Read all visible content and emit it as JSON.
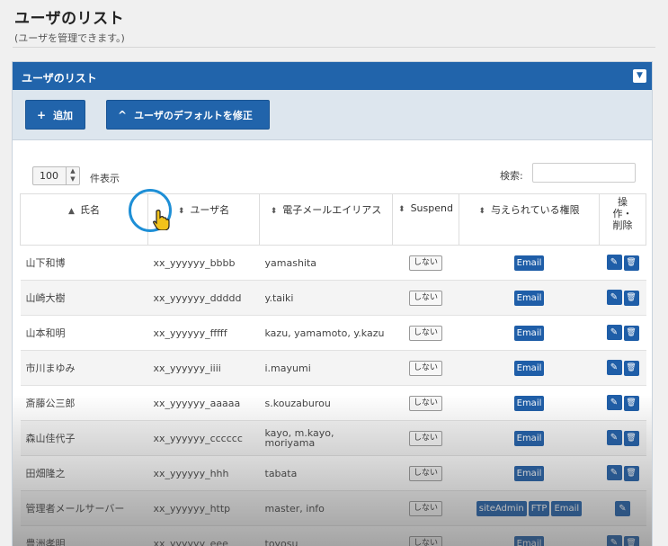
{
  "header": {
    "title": "ユーザのリスト",
    "subtitle": "(ユーザを管理できます。)"
  },
  "panel": {
    "title": "ユーザのリスト",
    "collapse_icon": "chevron-down-icon"
  },
  "toolbar": {
    "add_label": "追加",
    "add_icon": "+",
    "default_label": "ユーザのデフォルトを修正",
    "default_icon": "^"
  },
  "controls": {
    "page_length": "100",
    "page_length_label": "件表示",
    "search_label": "検索:",
    "search_value": ""
  },
  "table": {
    "columns": [
      {
        "label": "氏名",
        "sort": "▲"
      },
      {
        "label": "ユーザ名",
        "sort": "⬍"
      },
      {
        "label": "電子メールエイリアス",
        "sort": "⬍"
      },
      {
        "label": "Suspend",
        "sort": "⬍"
      },
      {
        "label": "与えられている権限",
        "sort": "⬍"
      },
      {
        "label": "操\n作・\n削除",
        "sort": ""
      }
    ],
    "suspend_label": "しない",
    "rows": [
      {
        "name": "山下和博",
        "user": "xx_yyyyyy_bbbb",
        "mail": "yamashita",
        "perms": [
          "Email"
        ],
        "delete": true
      },
      {
        "name": "山崎大樹",
        "user": "xx_yyyyyy_ddddd",
        "mail": "y.taiki",
        "perms": [
          "Email"
        ],
        "delete": true
      },
      {
        "name": "山本和明",
        "user": "xx_yyyyyy_fffff",
        "mail": "kazu, yamamoto, y.kazu",
        "perms": [
          "Email"
        ],
        "delete": true
      },
      {
        "name": "市川まゆみ",
        "user": "xx_yyyyyy_iiii",
        "mail": "i.mayumi",
        "perms": [
          "Email"
        ],
        "delete": true
      },
      {
        "name": "斎藤公三郎",
        "user": "xx_yyyyyy_aaaaa",
        "mail": "s.kouzaburou",
        "perms": [
          "Email"
        ],
        "delete": true
      },
      {
        "name": "森山佳代子",
        "user": "xx_yyyyyy_cccccc",
        "mail": "kayo, m.kayo, moriyama",
        "perms": [
          "Email"
        ],
        "delete": true
      },
      {
        "name": "田畑隆之",
        "user": "xx_yyyyyy_hhh",
        "mail": "tabata",
        "perms": [
          "Email"
        ],
        "delete": true
      },
      {
        "name": "管理者メールサーバー",
        "user": "xx_yyyyyy_http",
        "mail": "master, info",
        "perms": [
          "siteAdmin",
          "FTP",
          "Email"
        ],
        "delete": false
      },
      {
        "name": "豊洲孝明",
        "user": "xx_yyyyyy_eee",
        "mail": "toyosu",
        "perms": [
          "Email"
        ],
        "delete": true
      }
    ]
  },
  "colors": {
    "accent": "#2164ab",
    "highlight_ring": "#1e8fd6"
  }
}
